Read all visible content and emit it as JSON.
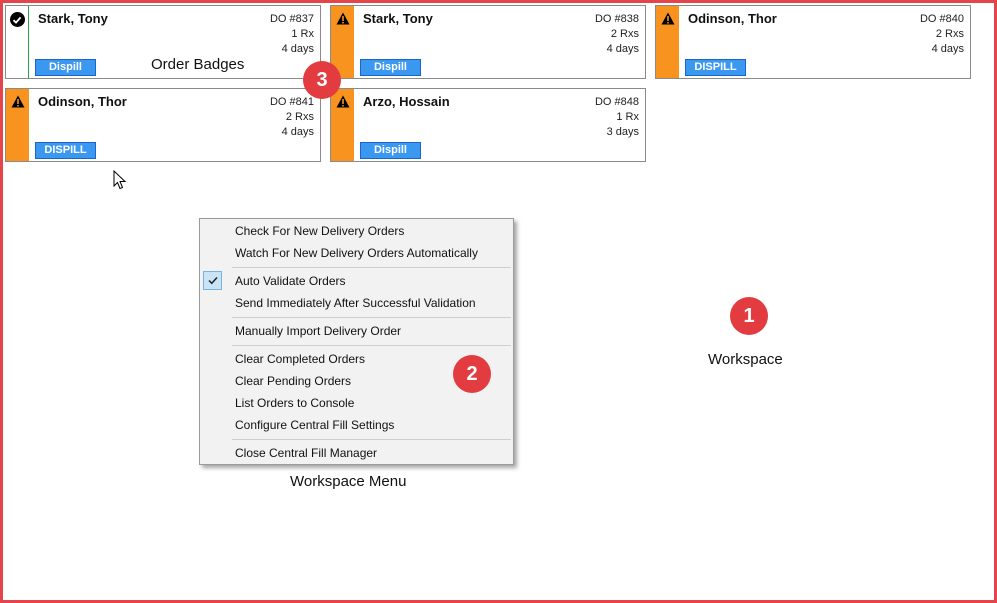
{
  "badges": [
    {
      "name": "Stark, Tony",
      "order": "DO #837",
      "rx": "1 Rx",
      "days": "4 days",
      "button": "Dispill",
      "status": "done"
    },
    {
      "name": "Stark, Tony",
      "order": "DO #838",
      "rx": "2 Rxs",
      "days": "4 days",
      "button": "Dispill",
      "status": "warning"
    },
    {
      "name": "Odinson, Thor",
      "order": "DO #840",
      "rx": "2 Rxs",
      "days": "4 days",
      "button": "DISPILL",
      "status": "warning"
    },
    {
      "name": "Odinson, Thor",
      "order": "DO #841",
      "rx": "2 Rxs",
      "days": "4 days",
      "button": "DISPILL",
      "status": "warning"
    },
    {
      "name": "Arzo, Hossain",
      "order": "DO #848",
      "rx": "1 Rx",
      "days": "3 days",
      "button": "Dispill",
      "status": "warning"
    }
  ],
  "annotations": {
    "order_badges": "Order Badges",
    "workspace": "Workspace",
    "workspace_menu": "Workspace Menu",
    "marker_1": "1",
    "marker_2": "2",
    "marker_3": "3"
  },
  "menu": {
    "items": [
      "Check For New Delivery Orders",
      "Watch For New Delivery Orders Automatically",
      "Auto Validate Orders",
      "Send Immediately After Successful Validation",
      "Manually Import Delivery Order",
      "Clear Completed Orders",
      "Clear Pending Orders",
      "List Orders to Console",
      "Configure Central Fill Settings",
      "Close Central Fill Manager"
    ],
    "checked_item": "Auto Validate Orders"
  },
  "colors": {
    "frame_red": "#e4454a",
    "warning_orange": "#f7931e",
    "button_blue": "#3a98f0",
    "marker_red": "#e23b40"
  }
}
